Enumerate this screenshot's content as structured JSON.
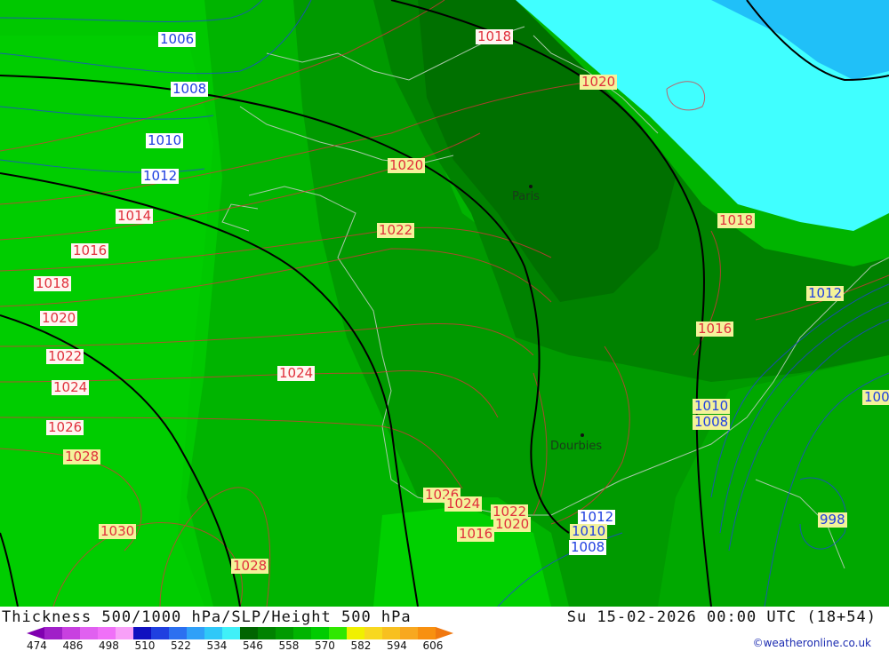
{
  "map": {
    "cities": [
      {
        "name": "Paris"
      },
      {
        "name": "Dourbies"
      }
    ],
    "slp_labels_red": [
      "1018",
      "1020",
      "1020",
      "1022",
      "1014",
      "1016",
      "1018",
      "1020",
      "1022",
      "1024",
      "1026",
      "1028",
      "1024",
      "1030",
      "1028",
      "1026",
      "1024",
      "1022",
      "1020",
      "1016",
      "1018",
      "1016"
    ],
    "slp_labels_blue": [
      "1006",
      "1008",
      "1010",
      "1012",
      "1012",
      "1010",
      "1008",
      "1012",
      "1010",
      "1008",
      "998",
      "100"
    ],
    "colors": {
      "thickness_546": "#009a00",
      "thickness_552": "#00b400",
      "thickness_558": "#00cc00",
      "thickness_540": "#008200",
      "thickness_534": "#006e00",
      "thickness_low": "#40ffff",
      "thickness_lower": "#20c0f8",
      "isobar_high": "#e0303c",
      "isobar_low": "#2040e0",
      "height_500": "#000000",
      "coastline": "#a8c8a8"
    }
  },
  "footer": {
    "title": "Thickness 500/1000 hPa/SLP/Height 500 hPa",
    "valid": "Su 15-02-2026 00:00 UTC (18+54)",
    "credit": "©weatheronline.co.uk",
    "scale_ticks": [
      "474",
      "486",
      "498",
      "510",
      "522",
      "534",
      "546",
      "558",
      "570",
      "582",
      "594",
      "606"
    ],
    "scale_colors": [
      "#8000b0",
      "#a020c8",
      "#c840e0",
      "#e060f0",
      "#f070f8",
      "#f8a0f8",
      "#1010c0",
      "#2040e0",
      "#2c70f0",
      "#30a0f8",
      "#30c8f8",
      "#40f0f8",
      "#006400",
      "#008200",
      "#009a00",
      "#00b400",
      "#00cc00",
      "#30e800",
      "#f0f000",
      "#f8d820",
      "#f8c020",
      "#f8a820",
      "#f89010",
      "#f07810"
    ]
  }
}
